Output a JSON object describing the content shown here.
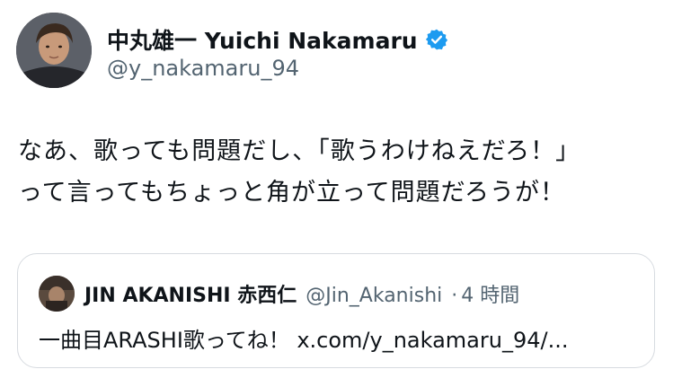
{
  "author": {
    "display_name": "中丸雄一 Yuichi Nakamaru",
    "handle": "@y_nakamaru_94",
    "verified": true,
    "avatar_icon": "profile-photo",
    "verified_icon": "verified-badge-icon"
  },
  "tweet": {
    "lines": [
      "なあ、歌っても問題だし、「歌うわけねえだろ！」",
      "って言ってもちょっと角が立って問題だろうが！"
    ]
  },
  "quote": {
    "display_name": "JIN AKANISHI 赤西仁",
    "handle": "@Jin_Akanishi",
    "separator": "·",
    "time": "4 時間",
    "text": "一曲目ARASHI歌ってね！ x.com/y_nakamaru_94/..."
  },
  "colors": {
    "text_primary": "#0f1419",
    "text_secondary": "#536471",
    "verified_blue": "#1d9bf0",
    "border": "#d7dbe0"
  }
}
